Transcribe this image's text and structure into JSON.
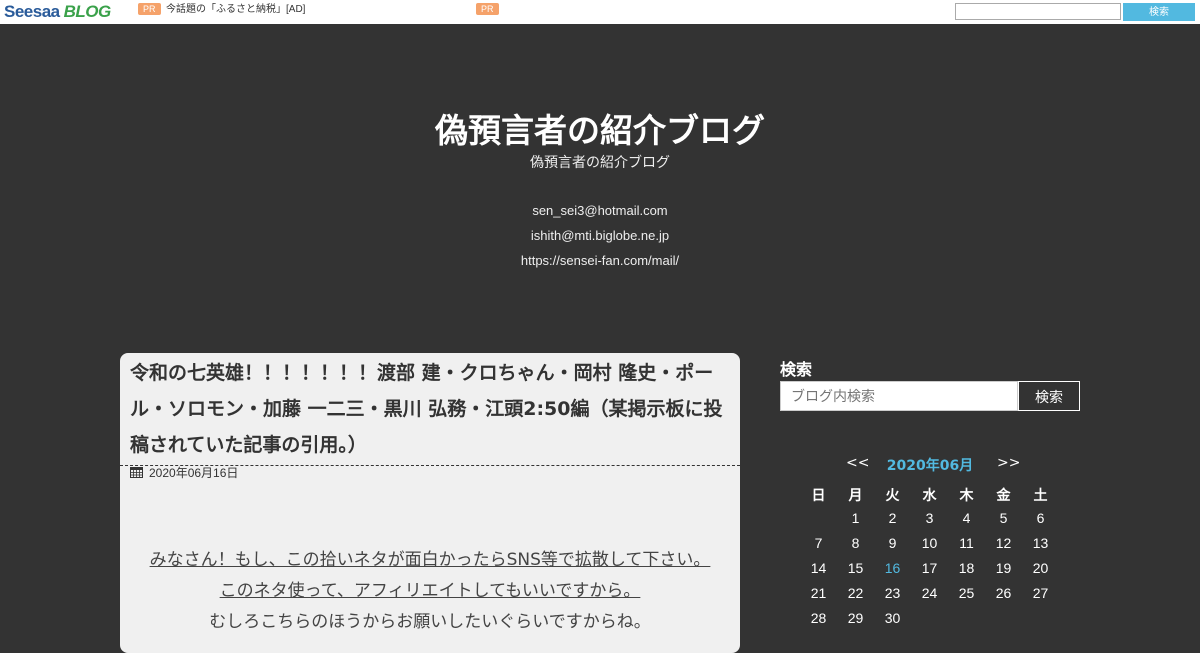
{
  "topbar": {
    "logo_part1": "Seesaa",
    "logo_part2": "BLOG",
    "pr1": "PR",
    "ad_text": "今話題の「ふるさと納税」[AD]",
    "pr2": "PR",
    "search_button": "検索"
  },
  "header": {
    "title": "偽預言者の紹介ブログ",
    "subtitle": "偽預言者の紹介ブログ",
    "contacts": [
      "sen_sei3@hotmail.com",
      "ishith@mti.biglobe.ne.jp",
      "https://sensei-fan.com/mail/"
    ]
  },
  "post": {
    "title": "令和の七英雄！！！！！！！渡部 建・クロちゃん・岡村 隆史・ポール・ソロモン・加藤 一二三・黒川 弘務・江頭2:50編（某掲示板に投稿されていた記事の引用。）",
    "date": "2020年06月16日",
    "body_lines": [
      "みなさん！もし、この拾いネタが面白かったらSNS等で拡散して下さい。",
      "このネタ使って、アフィリエイトしてもいいですから。",
      "むしろこちらのほうからお願いしたいぐらいですからね。"
    ]
  },
  "sidebar": {
    "search_label": "検索",
    "search_placeholder": "ブログ内検索",
    "search_button": "検索",
    "calendar": {
      "prev": "<<",
      "month": "2020年06月",
      "next": ">>",
      "weekdays": [
        "日",
        "月",
        "火",
        "水",
        "木",
        "金",
        "土"
      ],
      "start_offset": 1,
      "days": 30,
      "highlight_day": 16
    }
  },
  "colors": {
    "background": "#333333",
    "accent": "#52b9e0",
    "ad_pr": "#f5a26a"
  }
}
